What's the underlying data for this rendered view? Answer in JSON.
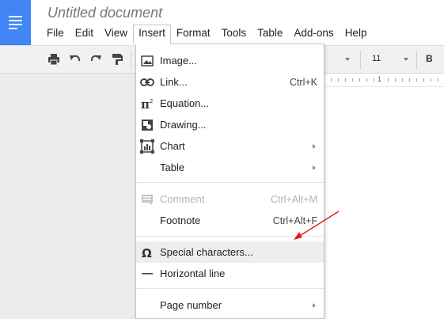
{
  "app": {
    "document_title": "Untitled document"
  },
  "menubar": {
    "items": [
      "File",
      "Edit",
      "View",
      "Insert",
      "Format",
      "Tools",
      "Table",
      "Add-ons",
      "Help"
    ],
    "active": "Insert"
  },
  "toolbar": {
    "icons": [
      "print-icon",
      "undo-icon",
      "redo-icon",
      "paint-format-icon"
    ],
    "font_size": "11",
    "bold_label": "B"
  },
  "ruler": {
    "label": "1"
  },
  "insert_menu": {
    "items": [
      {
        "label": "Image...",
        "icon": "image-icon",
        "shortcut": "",
        "submenu": false,
        "disabled": false
      },
      {
        "label": "Link...",
        "icon": "link-icon",
        "shortcut": "Ctrl+K",
        "submenu": false,
        "disabled": false
      },
      {
        "label": "Equation...",
        "icon": "pi-icon",
        "shortcut": "",
        "submenu": false,
        "disabled": false
      },
      {
        "label": "Drawing...",
        "icon": "drawing-icon",
        "shortcut": "",
        "submenu": false,
        "disabled": false
      },
      {
        "label": "Chart",
        "icon": "chart-icon",
        "shortcut": "",
        "submenu": true,
        "disabled": false
      },
      {
        "label": "Table",
        "icon": "",
        "shortcut": "",
        "submenu": true,
        "disabled": false
      },
      {
        "label": "Comment",
        "icon": "comment-icon",
        "shortcut": "Ctrl+Alt+M",
        "submenu": false,
        "disabled": true
      },
      {
        "label": "Footnote",
        "icon": "",
        "shortcut": "Ctrl+Alt+F",
        "submenu": false,
        "disabled": false
      },
      {
        "label": "Special characters...",
        "icon": "omega-icon",
        "shortcut": "",
        "submenu": false,
        "disabled": false,
        "highlighted": true
      },
      {
        "label": "Horizontal line",
        "icon": "horizontal-line-icon",
        "shortcut": "",
        "submenu": false,
        "disabled": false
      },
      {
        "label": "Page number",
        "icon": "",
        "shortcut": "",
        "submenu": true,
        "disabled": false
      }
    ]
  },
  "colors": {
    "docs_blue": "#4285f4",
    "annotation_arrow": "#e02020",
    "highlight_row": "#eeeeee"
  }
}
